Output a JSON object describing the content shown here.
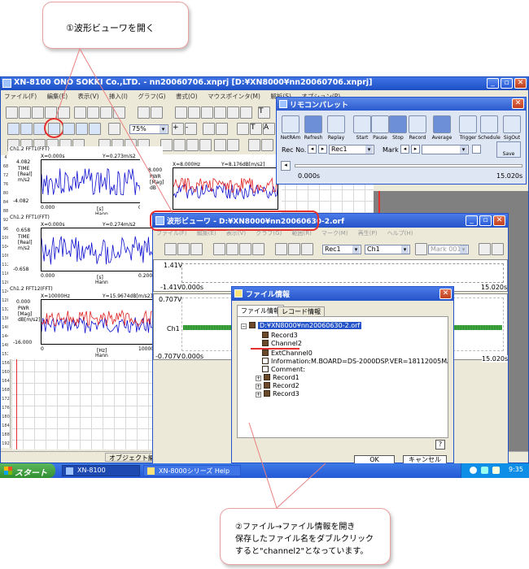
{
  "callout_top": {
    "text": "①波形ビューワを開く"
  },
  "callout_bottom": {
    "line1": "②ファイル→ファイル情報を開き",
    "line2": "保存したファイル名をダブルクリック",
    "line3": "すると\"channel2\"となっています。"
  },
  "main_window": {
    "title": "XN-8100 ONO SOKKI Co.,LTD. - nn20060706.xnprj [D:¥XN8000¥nn20060706.xnprj]",
    "menu": [
      "ファイル(F)",
      "編集(E)",
      "表示(V)",
      "挿入(I)",
      "グラフ(G)",
      "書式(O)",
      "マウスポインタ(M)",
      "解析(S)",
      "オプション(P)"
    ],
    "zoom": "75%",
    "status": "オブジェクト編集モード",
    "ruler_marks": [
      "4",
      "68",
      "72",
      "76",
      "80",
      "84",
      "88",
      "92",
      "96",
      "100",
      "104",
      "108",
      "112",
      "116",
      "120",
      "124",
      "128",
      "132",
      "136",
      "140",
      "144",
      "148",
      "152",
      "156",
      "160",
      "164",
      "168",
      "172",
      "176",
      "180",
      "184",
      "188",
      "192"
    ]
  },
  "graphs": [
    {
      "title": "Ch1.2 FFT1(FFT)",
      "top": "Y=0.273m/s2",
      "xinfo": "X=0.000s",
      "ymax": "4.082",
      "ymin": "-4.082",
      "yunit1": "TIME",
      "yunit2": "[Real]",
      "yunit3": "m/s2",
      "x0": "0.000",
      "x1": "0.200",
      "xu": "[s]",
      "xw": "Hann"
    },
    {
      "title": "Ch1.2 FFT1(FFT)",
      "top": "Y=0.274m/s2",
      "xinfo": "X=0.000s",
      "ymax": "0.658",
      "ymin": "-0.658",
      "yunit1": "TIME",
      "yunit2": "[Real]",
      "yunit3": "m/s2",
      "x0": "0.000",
      "x1": "0.200",
      "xu": "[s]",
      "xw": "Hann"
    },
    {
      "title": "Ch1.2 FFT12(FFT)",
      "top": "Y=15.9674dB[m/s2]",
      "xinfo": "X=10000Hz",
      "ymax": "0.000",
      "ymin": "-16.000",
      "yunit1": "PWR",
      "yunit2": "[Mag]",
      "yunit3": "dB[m/s2]",
      "x0": "0",
      "x1": "10000.0",
      "xu": "[Hz]",
      "xw": "Hann"
    },
    {
      "title": "",
      "top": "Y=8.176dB[m/s2]",
      "xinfo": "X=8.000Hz",
      "ymax": "8.000",
      "ymin": "",
      "yunit1": "PWR",
      "yunit2": "[Mag]",
      "yunit3": "dB",
      "x0": "",
      "x1": "",
      "xu": "",
      "xw": ""
    }
  ],
  "remote": {
    "title": "リモコンパレット",
    "buttons": [
      "NetRAm",
      "Refresh",
      "Replay",
      "Start",
      "Pause",
      "Stop",
      "Record",
      "Average",
      "Trigger",
      "Schedule",
      "SigOut"
    ],
    "rec_label": "Rec No.",
    "rec_value": "Rec1",
    "mark_label": "Mark",
    "save_label": "Save",
    "time_start": "0.000s",
    "time_end": "15.020s"
  },
  "viewer": {
    "title": "波形ビューワ - D:¥XN8000¥nn20060630-2.orf",
    "menu": [
      "ファイル(F)",
      "編集(E)",
      "表示(V)",
      "グラフ(G)",
      "範囲(R)",
      "マーク(M)",
      "再生(P)",
      "ヘルプ(H)"
    ],
    "rec": "Rec1",
    "ch": "Ch1",
    "mark": "Mark 001",
    "top_ymax": "1.41V",
    "top_ymin": "-1.41V",
    "top_t0": "0.000s",
    "top_t1": "15.020s",
    "bottom_ymax": "0.707V",
    "bottom_ymin": "-0.707V",
    "bottom_label": "Ch1",
    "bottom_t0": "0.000s",
    "bottom_t1": "15.020s"
  },
  "file_info": {
    "title": "ファイル情報",
    "tabs": [
      "ファイル情報",
      "レコード情報"
    ],
    "root": "D:¥XN8000¥nn20060630-2.orf",
    "items": [
      "Record3",
      "Channel2",
      "ExtChannel0",
      "Information:M.BOARD=DS-2000DSP.VER=18112005MAIN.UNIT=C",
      "Comment:",
      "Record1",
      "Record2",
      "Record3"
    ],
    "ok": "OK",
    "cancel": "キャンセル",
    "help": "?"
  },
  "taskbar": {
    "start": "スタート",
    "tasks": [
      "XN-8100",
      "XN-8000シリーズ Help"
    ],
    "clock": "9:35"
  },
  "colors": {
    "title_blue": "#2553c9",
    "accent_red": "#e53030",
    "wave_blue": "#1010d0",
    "wave_red": "#e02020",
    "wave_green": "#1a8a1a"
  }
}
